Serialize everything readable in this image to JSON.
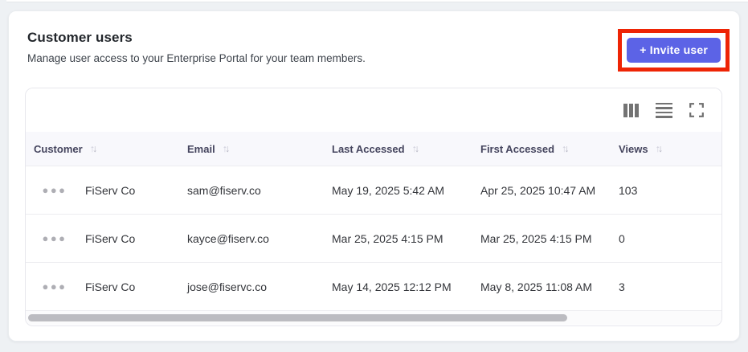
{
  "page": {
    "title": "Customer users",
    "subtitle": "Manage user access to your Enterprise Portal for your team members."
  },
  "invite": {
    "label": "+ Invite user",
    "button_color": "#5c63e6",
    "annotation_color": "#ee2405"
  },
  "toolbar": {
    "icons": [
      "columns-icon",
      "density-icon",
      "fullscreen-icon"
    ]
  },
  "table": {
    "columns": [
      {
        "label": "Customer",
        "sortable": true
      },
      {
        "label": "Email",
        "sortable": true
      },
      {
        "label": "Last Accessed",
        "sortable": true
      },
      {
        "label": "First Accessed",
        "sortable": true
      },
      {
        "label": "Views",
        "sortable": true
      }
    ],
    "rows": [
      {
        "customer": "FiServ Co",
        "email": "sam@fiserv.co",
        "last_accessed": "May 19, 2025 5:42 AM",
        "first_accessed": "Apr 25, 2025 10:47 AM",
        "views": "103"
      },
      {
        "customer": "FiServ Co",
        "email": "kayce@fiserv.co",
        "last_accessed": "Mar 25, 2025 4:15 PM",
        "first_accessed": "Mar 25, 2025 4:15 PM",
        "views": "0"
      },
      {
        "customer": "FiServ Co",
        "email": "jose@fiservc.co",
        "last_accessed": "May 14, 2025 12:12 PM",
        "first_accessed": "May 8, 2025 11:08 AM",
        "views": "3"
      }
    ]
  }
}
